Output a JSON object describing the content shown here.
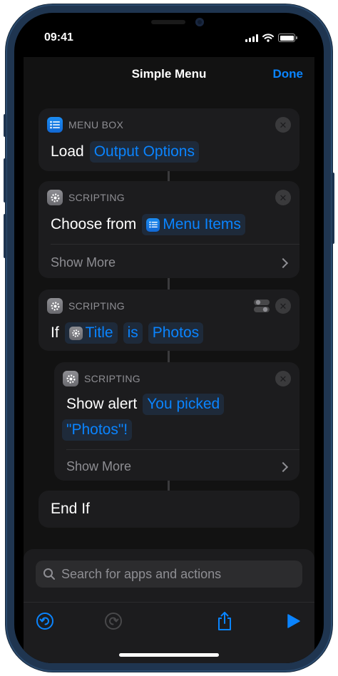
{
  "status": {
    "time": "09:41"
  },
  "nav": {
    "title": "Simple Menu",
    "done_label": "Done"
  },
  "actions": {
    "menu_box": {
      "category": "MENU BOX",
      "verb": "Load",
      "token": "Output Options"
    },
    "choose": {
      "category": "SCRIPTING",
      "verb": "Choose from",
      "token": "Menu Items",
      "show_more": "Show More"
    },
    "if": {
      "category": "SCRIPTING",
      "verb": "If",
      "token_title": "Title",
      "operator": "is",
      "value": "Photos"
    },
    "alert": {
      "category": "SCRIPTING",
      "verb": "Show alert",
      "message_line1": "You picked",
      "message_line2": "\"Photos\"!",
      "show_more": "Show More"
    },
    "end_if": {
      "label": "End If"
    }
  },
  "search": {
    "placeholder": "Search for apps and actions"
  },
  "colors": {
    "accent": "#0a84ff",
    "card": "#1c1c1e",
    "background": "#121212"
  },
  "icons": {
    "menu_box": "list-icon",
    "scripting": "gear-icon",
    "close": "close-icon",
    "toggle": "toggle-icon",
    "search": "search-icon",
    "undo": "undo-icon",
    "redo": "redo-icon",
    "share": "share-icon",
    "play": "play-icon"
  }
}
